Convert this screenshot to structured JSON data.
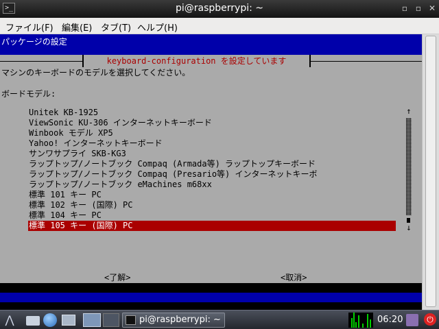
{
  "window": {
    "title": "pi@raspberrypi: ~",
    "minimize_glyph": "▫",
    "maximize_glyph": "▫",
    "close_glyph": "✕"
  },
  "menubar": {
    "items": [
      "ファイル(F)",
      "編集(E)",
      "タブ(T)",
      "ヘルプ(H)"
    ]
  },
  "terminal": {
    "header": "パッケージの設定",
    "dialog": {
      "title": "keyboard-configuration を設定しています",
      "prompt": "マシンのキーボードのモデルを選択してください。",
      "field_label": "ボードモデル:",
      "options": [
        "Unitek KB-1925",
        "ViewSonic KU-306 インターネットキーボード",
        "Winbook モデル XP5",
        "Yahoo! インターネットキーボード",
        "サンワサプライ SKB-KG3",
        "ラップトップ/ノートブック Compaq (Armada等) ラップトップキーボード",
        "ラップトップ/ノートブック Compaq (Presario等) インターネットキーボ",
        "ラップトップ/ノートブック eMachines m68xx",
        "標準 101 キー PC",
        "標準 102 キー (国際) PC",
        "標準 104 キー PC",
        "標準 105 キー (国際) PC"
      ],
      "selected_index": 11,
      "scroll_up_glyph": "↑",
      "scroll_down_glyph": "↓",
      "ok_label": "<了解>",
      "cancel_label": "<取消>"
    }
  },
  "taskbar": {
    "menu_glyph": "⋀",
    "task_label": "pi@raspberrypi: ~",
    "clock": "06:20",
    "power_glyph": "⏻"
  }
}
